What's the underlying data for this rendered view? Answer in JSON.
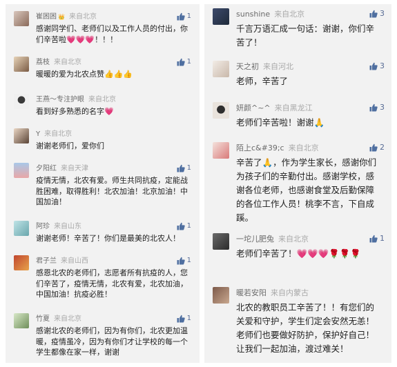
{
  "left_comments": [
    {
      "name": "崔困困",
      "badge": "👑",
      "location": "来自北京",
      "likes": "1",
      "text": "感谢同学们、老师们以及工作人员的付出，你们辛苦啦💗💗💗！！！"
    },
    {
      "name": "荔枝",
      "badge": "",
      "location": "来自北京",
      "likes": "1",
      "text": "暖暖的爱为北农点赞👍👍👍"
    },
    {
      "name": "王燕～专注护眼",
      "badge": "",
      "location": "来自北京",
      "likes": "",
      "text": "看到好多熟悉的名字💗"
    },
    {
      "name": "Y",
      "badge": "",
      "location": "来自北京",
      "likes": "",
      "text": "谢谢老师们，爱你们"
    },
    {
      "name": "夕阳红",
      "badge": "",
      "location": "来自天津",
      "likes": "1",
      "text": "疫情无情，北农有爱。师生共同抗疫，定能战胜困难，取得胜利！北农加油！北京加油！中国加油！"
    },
    {
      "name": "阿珍",
      "badge": "",
      "location": "来自山东",
      "likes": "1",
      "text": "谢谢老师！辛苦了！你们是最美的北农人！"
    },
    {
      "name": "君子兰",
      "badge": "",
      "location": "来自山西",
      "likes": "1",
      "text": "感恩北农的老师们，志愿者所有抗疫的人，您们辛苦了，疫情无情，北农有爱，北农加油，中国加油！抗疫必胜！"
    },
    {
      "name": "竹夏",
      "badge": "",
      "location": "来自北京",
      "likes": "1",
      "text": "感谢北农的老师们，因为有你们，北农更加温暖，疫情虽冷，因为有你们才让学校的每一个学生都像在家一样，谢谢"
    }
  ],
  "right_comments": [
    {
      "name": "sunshine",
      "location": "来自北京",
      "likes": "3",
      "text": "千言万语汇成一句话：谢谢，你们辛苦了！"
    },
    {
      "name": "天之初",
      "location": "来自河北",
      "likes": "3",
      "text": "老师，辛苦了"
    },
    {
      "name": "妍颜^~^",
      "location": "来自黑龙江",
      "likes": "3",
      "text": "老师们辛苦啦！谢谢🙏"
    },
    {
      "name": "陌上c&#39;c",
      "location": "来自北京",
      "likes": "2",
      "text": "辛苦了🙏，作为学生家长，感谢你们为孩子们的辛勤付出。感谢学校，感谢各位老师，也感谢食堂及后勤保障的各位工作人员！桃李不言，下自成蹊。"
    },
    {
      "name": "一坨儿肥兔",
      "location": "来自北京",
      "likes": "1",
      "text": "老师们辛苦了！💗💗💗🌹🌹🌹"
    },
    {
      "name": "暖若安阳",
      "location": "来自内蒙古",
      "likes": "",
      "text": "北农的教职员工辛苦了！！有您们的关爱和守护，学生们定会安然无恙！老师们也要做好防护，保护好自己！让我们一起加油，渡过难关！"
    }
  ]
}
